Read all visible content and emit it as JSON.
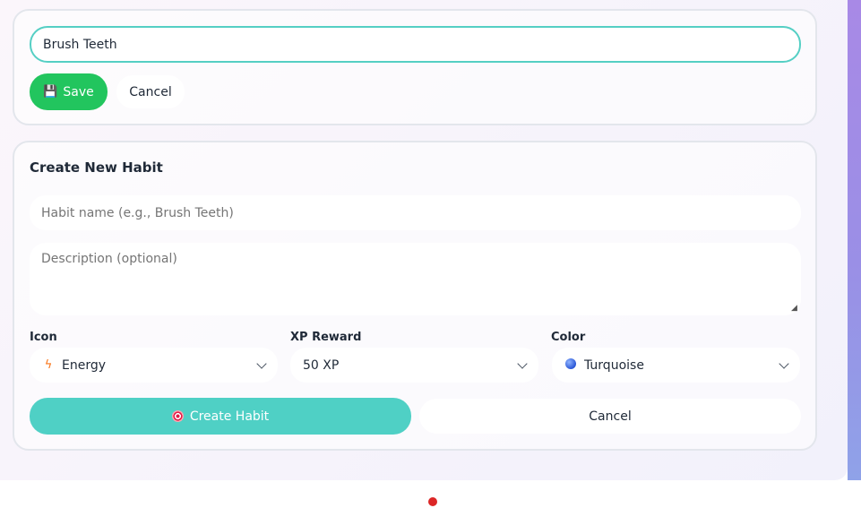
{
  "edit_form": {
    "name_value": "Brush Teeth",
    "save_label": "Save",
    "cancel_label": "Cancel"
  },
  "create_form": {
    "title": "Create New Habit",
    "name_placeholder": "Habit name (e.g., Brush Teeth)",
    "description_placeholder": "Description (optional)",
    "icon": {
      "label": "Icon",
      "selected": "Energy",
      "icon_name": "lightning-icon"
    },
    "xp": {
      "label": "XP Reward",
      "selected": "50 XP"
    },
    "color": {
      "label": "Color",
      "selected": "Turquoise",
      "swatch_name": "blue-ball-icon"
    },
    "create_label": "Create Habit",
    "cancel_label": "Cancel"
  },
  "colors": {
    "accent": "#4fd0c5",
    "save": "#22c55e",
    "input_border": "#55cfc4",
    "dot": "#dc2626"
  }
}
